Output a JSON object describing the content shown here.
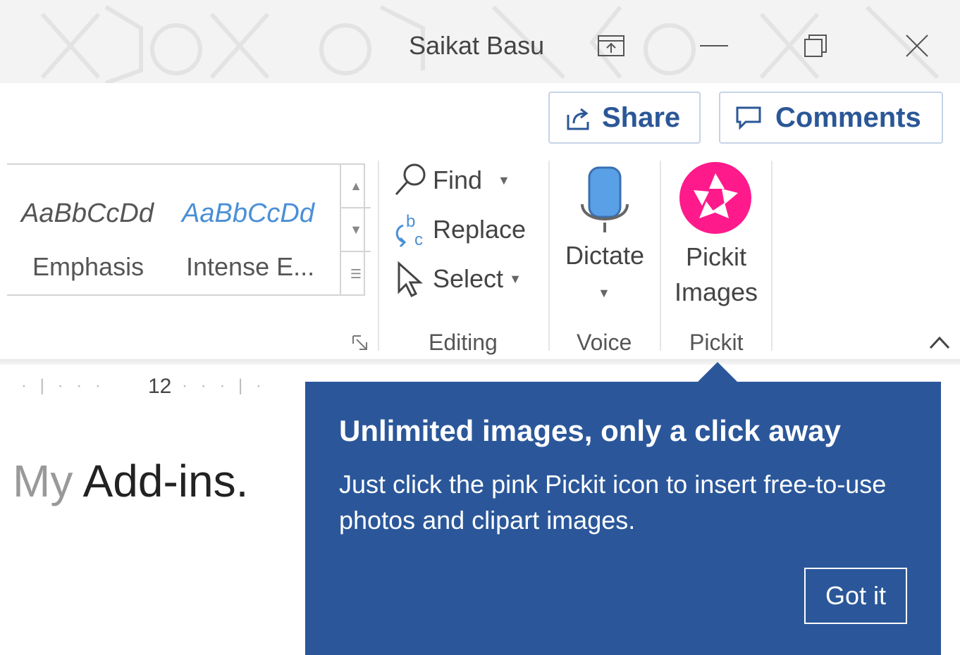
{
  "titlebar": {
    "user_name": "Saikat Basu"
  },
  "actions": {
    "share_label": "Share",
    "comments_label": "Comments"
  },
  "styles": [
    {
      "sample": "AaBbCcDd",
      "name": "Emphasis"
    },
    {
      "sample": "AaBbCcDd",
      "name": "Intense E..."
    }
  ],
  "editing": {
    "find_label": "Find",
    "replace_label": "Replace",
    "select_label": "Select",
    "group_label": "Editing"
  },
  "voice": {
    "dictate_label": "Dictate",
    "group_label": "Voice"
  },
  "pickit": {
    "button_label_line1": "Pickit",
    "button_label_line2": "Images",
    "group_label": "Pickit"
  },
  "ruler": {
    "mark": "12"
  },
  "document": {
    "faded_text": "My",
    "text": " Add-ins."
  },
  "callout": {
    "title": "Unlimited images, only a click away",
    "body": "Just click the pink Pickit icon to insert free-to-use photos and clipart images.",
    "button_label": "Got it"
  },
  "colors": {
    "accent": "#2b579a",
    "pickit_pink": "#ff1a8c",
    "mic_blue": "#5aa0e6"
  }
}
